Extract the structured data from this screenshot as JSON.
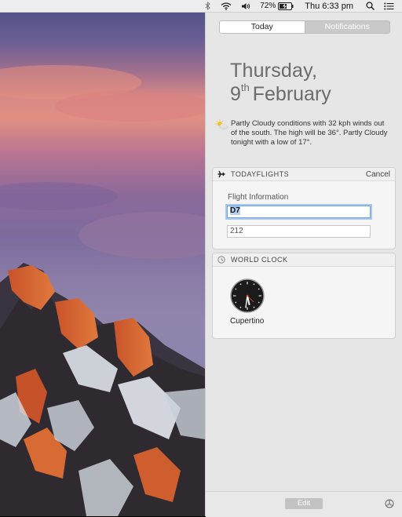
{
  "menubar": {
    "battery_percent": "72%",
    "clock": "Thu 6:33 pm",
    "icons": [
      "bluetooth-icon",
      "wifi-icon",
      "volume-icon",
      "battery-icon",
      "spotlight-search-icon",
      "notification-center-icon"
    ]
  },
  "notification_center": {
    "tabs": [
      {
        "label": "Today",
        "active": true
      },
      {
        "label": "Notifications",
        "active": false
      }
    ],
    "date": {
      "weekday": "Thursday,",
      "day": "9",
      "suffix": "th",
      "month": "February"
    },
    "weather": {
      "icon": "partly-cloudy-icon",
      "text": "Partly Cloudy conditions with 32 kph winds out of the south. The high will be 36°. Partly Cloudy tonight with a low of 17°."
    },
    "flights_widget": {
      "title": "TODAYFLIGHTS",
      "cancel_label": "Cancel",
      "field_label": "Flight Information",
      "airline_code": "D7",
      "flight_number": "212"
    },
    "world_clock_widget": {
      "title": "WORLD CLOCK",
      "city": "Cupertino",
      "time_shown": "6:33"
    },
    "edit_label": "Edit"
  }
}
